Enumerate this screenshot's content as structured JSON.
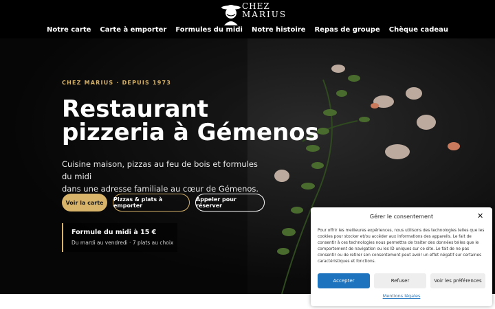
{
  "brand": {
    "line1": "CHEZ",
    "line2": "MARIUS"
  },
  "nav": {
    "items": [
      {
        "label": "Notre carte"
      },
      {
        "label": "Carte à emporter"
      },
      {
        "label": "Formules du midi"
      },
      {
        "label": "Notre histoire"
      },
      {
        "label": "Repas de groupe"
      },
      {
        "label": "Chèque cadeau"
      }
    ]
  },
  "hero": {
    "eyebrow": "CHEZ MARIUS · DEPUIS 1973",
    "title_line1": "Restaurant",
    "title_line2": "pizzeria à Gémenos",
    "subtitle_line1": "Cuisine maison, pizzas au feu de bois et formules du midi",
    "subtitle_line2": "dans une adresse familiale au cœur de Gémenos.",
    "buttons": {
      "primary": "Voir la carte",
      "takeaway": "Pizzas & plats à emporter",
      "call": "Appeler pour réserver"
    },
    "promo": {
      "title": "Formule du midi à 15 €",
      "subtitle": "Du mardi au vendredi · 7 plats au choix"
    }
  },
  "consent": {
    "title": "Gérer le consentement",
    "body": "Pour offrir les meilleures expériences, nous utilisons des technologies telles que les cookies pour stocker et/ou accéder aux informations des appareils. Le fait de consentir à ces technologies nous permettra de traiter des données telles que le comportement de navigation ou les ID uniques sur ce site. Le fait de ne pas consentir ou de retirer son consentement peut avoir un effet négatif sur certaines caractéristiques et fonctions.",
    "accept": "Accepter",
    "refuse": "Refuser",
    "preferences": "Voir les préférences",
    "legal": "Mentions légales",
    "close_icon": "close-icon"
  },
  "colors": {
    "accent_gold": "#d8b36a",
    "consent_blue": "#1e73be",
    "header_bg": "#000000"
  }
}
